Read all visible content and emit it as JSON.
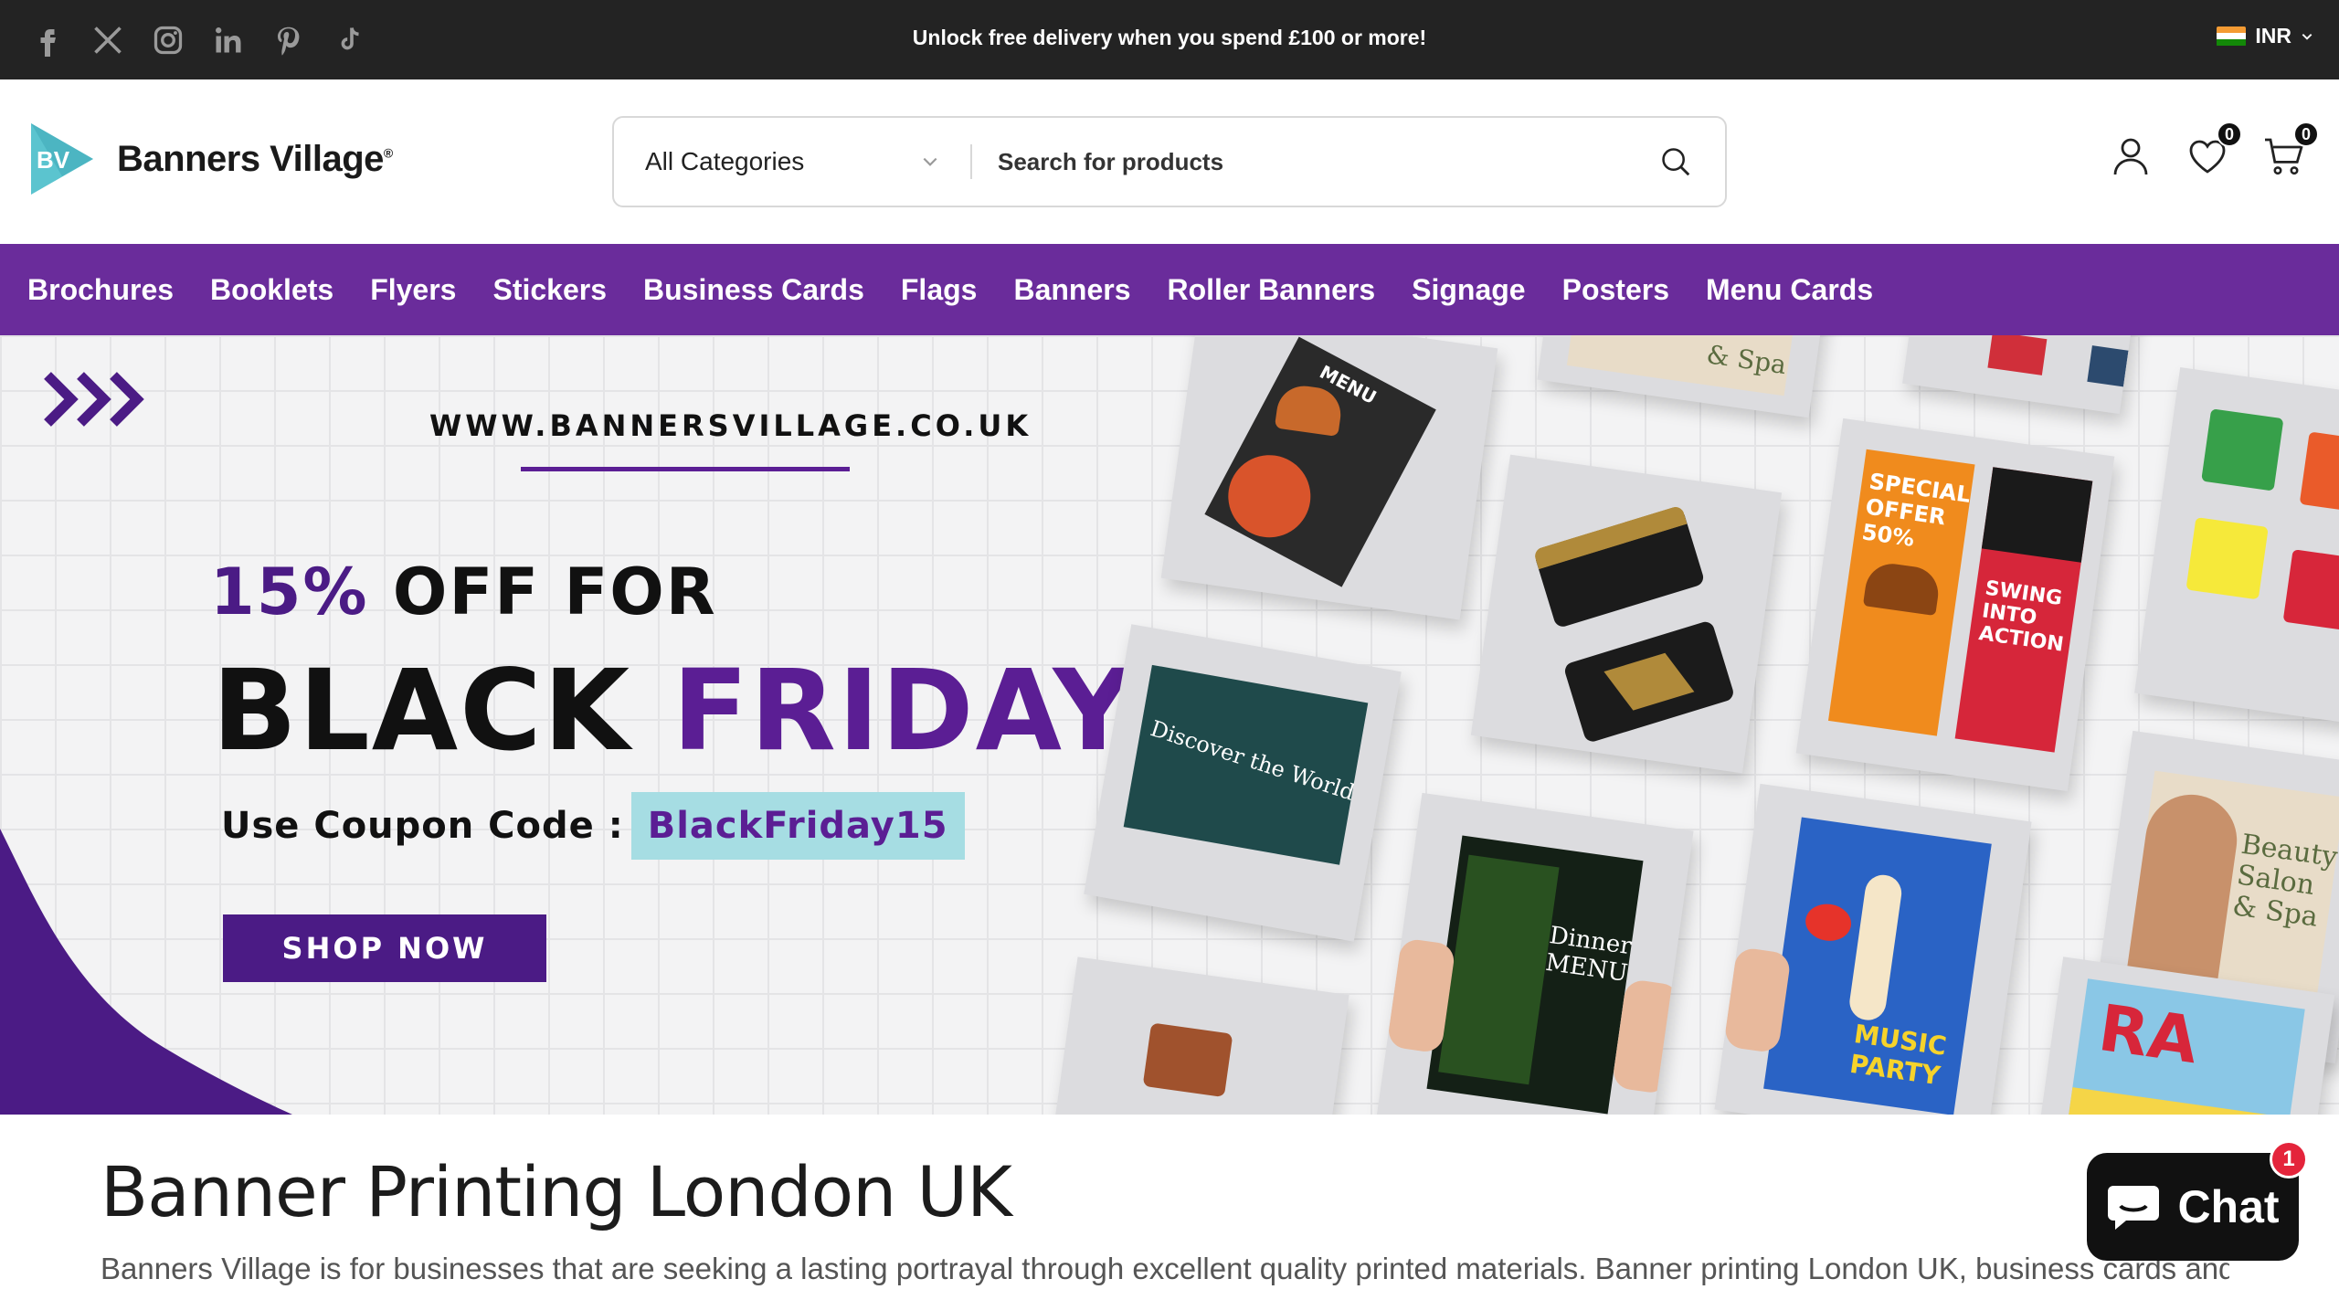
{
  "topbar": {
    "socials": [
      "facebook-icon",
      "x-icon",
      "instagram-icon",
      "linkedin-icon",
      "pinterest-icon",
      "tiktok-icon"
    ],
    "promo": "Unlock free delivery when you spend £100 or more!",
    "currency": "INR"
  },
  "header": {
    "logo_mark": "BV",
    "logo_text": "Banners Village",
    "logo_reg": "®",
    "category_select": "All Categories",
    "search_placeholder": "Search for products",
    "wishlist_count": "0",
    "cart_count": "0"
  },
  "nav": {
    "items": [
      "Brochures",
      "Booklets",
      "Flyers",
      "Stickers",
      "Business Cards",
      "Flags",
      "Banners",
      "Roller Banners",
      "Signage",
      "Posters",
      "Menu Cards"
    ]
  },
  "hero": {
    "url": "WWW.BANNERSVILLAGE.CO.UK",
    "pct": "15%",
    "off_for": " OFF FOR",
    "black": "BLACK ",
    "friday": "FRIDAY",
    "coupon_label": "Use Coupon Code :",
    "coupon_code": "BlackFriday15",
    "cta": "SHOP NOW",
    "card_texts": {
      "menu": "MENU",
      "discover": "Discover the World",
      "dinner": "Dinner MENU",
      "music": "MUSIC PARTY",
      "special": "SPECIAL OFFER 50%",
      "swing": "SWING INTO ACTION",
      "beauty": "Beauty Salon & Spa",
      "spa_top": "& Spa",
      "ra": "RA"
    }
  },
  "content": {
    "title": "Banner Printing London UK",
    "intro": "Banners Village is for businesses that are seeking a lasting portrayal through excellent quality printed materials. Banner printing London UK, business cards and"
  },
  "chat": {
    "label": "Chat",
    "badge": "1"
  },
  "colors": {
    "brand_purple": "#6a2c9b",
    "topbar": "#232323",
    "coupon_bg": "#a6dde3"
  }
}
